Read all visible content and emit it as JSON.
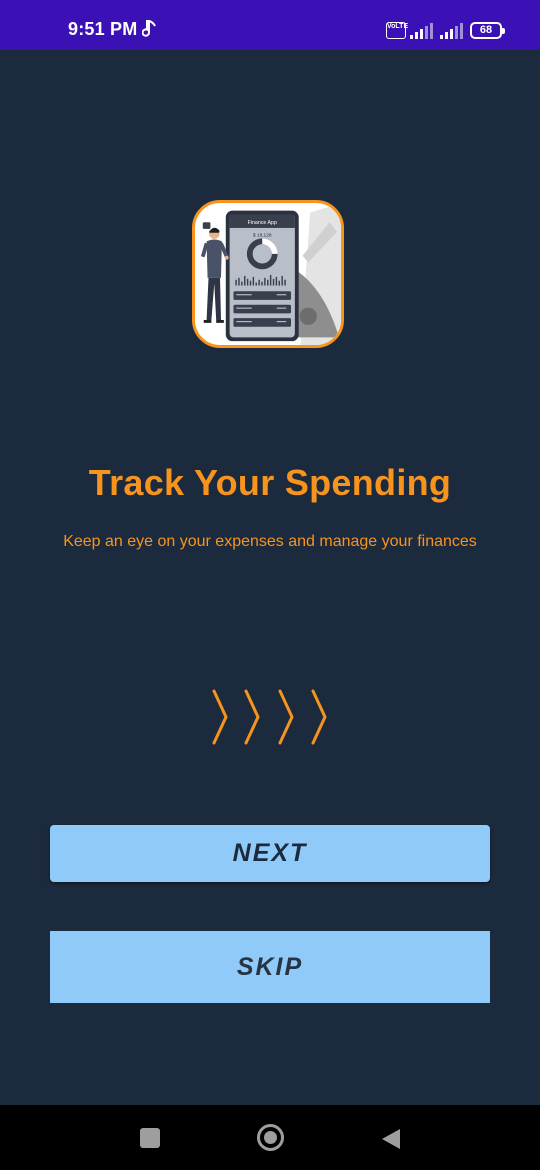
{
  "status_bar": {
    "time": "9:51 PM",
    "battery": "68",
    "network": "VoLTE",
    "icons": [
      "music-note-icon",
      "volte-icon",
      "signal-icon",
      "signal-icon",
      "battery-icon"
    ]
  },
  "illustration": {
    "app_title": "Finance App",
    "balance": "$ 18,128"
  },
  "onboarding": {
    "title": "Track Your Spending",
    "subtitle": "Keep an eye on your expenses and manage your finances"
  },
  "actions": {
    "next_label": "NEXT",
    "skip_label": "SKIP"
  },
  "navigation": {
    "icons": [
      "recents-icon",
      "home-icon",
      "back-icon"
    ]
  },
  "colors": {
    "background": "#1c2a3d",
    "status_bar": "#3b10b5",
    "accent": "#f7941d",
    "button": "#90caf9",
    "nav_bar": "#000000"
  }
}
